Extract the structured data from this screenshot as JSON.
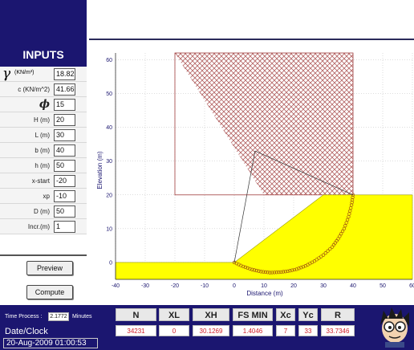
{
  "inputs_panel": {
    "title": "INPUTS",
    "gamma_unit": "(KN/m³)",
    "fields": [
      {
        "label": "",
        "value": "18.82"
      },
      {
        "label": "c (KN/m^2)",
        "value": "41.66"
      },
      {
        "label": "ϕ",
        "value": "15"
      },
      {
        "label": "H (m)",
        "value": "20"
      },
      {
        "label": "L (m)",
        "value": "30"
      },
      {
        "label": "b (m)",
        "value": "40"
      },
      {
        "label": "h (m)",
        "value": "50"
      },
      {
        "label": "x-start",
        "value": "-20"
      },
      {
        "label": "xp",
        "value": "-10"
      },
      {
        "label": "D (m)",
        "value": "50"
      },
      {
        "label": "Incr.(m)",
        "value": "1"
      }
    ]
  },
  "buttons": {
    "preview": "Preview",
    "compute": "Compute"
  },
  "chart_data": {
    "type": "scatter",
    "title": "",
    "xlabel": "Distance (m)",
    "ylabel": "Elevation (m)",
    "xlim": [
      -40,
      60
    ],
    "ylim": [
      -5,
      62
    ],
    "x_ticks": [
      -40,
      -30,
      -20,
      -10,
      0,
      10,
      20,
      30,
      40,
      50,
      60
    ],
    "y_ticks": [
      0,
      10,
      20,
      30,
      40,
      50,
      60
    ],
    "grid": true,
    "slope_colour": "#ffff00",
    "hatch_colour": "#a03c3c",
    "ground_profile": [
      [
        -40,
        0
      ],
      [
        0,
        0
      ],
      [
        30,
        20
      ],
      [
        60,
        20
      ]
    ],
    "search_box": {
      "x": [
        -20,
        40
      ],
      "y": [
        20,
        62
      ]
    },
    "critical_centre": [
      7,
      33
    ],
    "critical_radius": 33.7346,
    "slip_surface": [
      [
        0,
        0
      ],
      [
        3,
        -1.2
      ],
      [
        6,
        -2.1
      ],
      [
        9,
        -2.7
      ],
      [
        12,
        -3.0
      ],
      [
        15,
        -2.9
      ],
      [
        18,
        -2.6
      ],
      [
        21,
        -2.0
      ],
      [
        24,
        -1.0
      ],
      [
        27,
        0.4
      ],
      [
        30,
        2.2
      ],
      [
        33,
        4.6
      ],
      [
        35,
        7.0
      ],
      [
        37,
        10.0
      ],
      [
        38.5,
        13.5
      ],
      [
        39.5,
        17.0
      ],
      [
        40,
        20
      ]
    ]
  },
  "status_bar": {
    "time_label": "Time Process :",
    "time_value": "2.1772",
    "time_unit": "Minutes",
    "date_label": "Date/Clock",
    "date_value": "20-Aug-2009 01:00:53"
  },
  "results": [
    {
      "name": "N",
      "value": "34231"
    },
    {
      "name": "XL",
      "value": "0"
    },
    {
      "name": "XH",
      "value": "30.1269"
    },
    {
      "name": "FS MIN",
      "value": "1.4046"
    },
    {
      "name": "Xc",
      "value": "7"
    },
    {
      "name": "Yc",
      "value": "33"
    },
    {
      "name": "R",
      "value": "33.7346"
    }
  ],
  "icons": {
    "avatar": "cartoon-avatar-icon"
  }
}
